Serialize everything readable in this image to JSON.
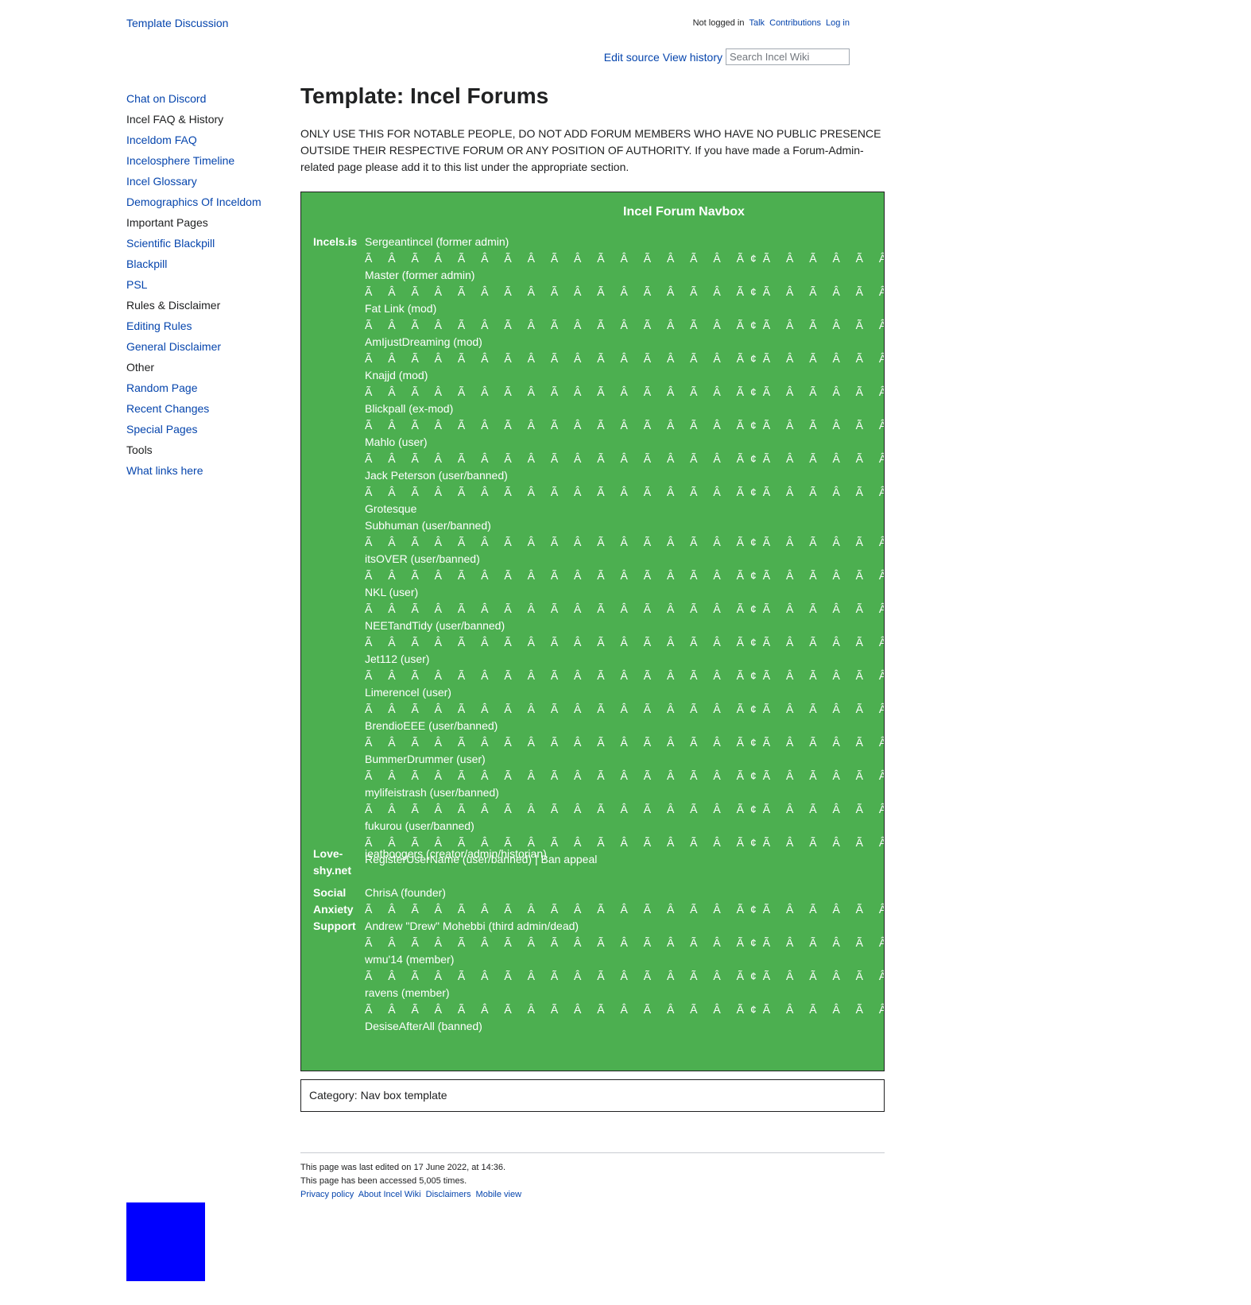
{
  "header": {
    "namespace_tabs": [
      "Template",
      "Discussion"
    ],
    "personal": {
      "status": "Not logged in",
      "links": [
        "Talk",
        "Contributions",
        "Log in"
      ]
    },
    "actions": [
      "Edit source",
      "View history"
    ],
    "search_placeholder": "Search Incel Wiki"
  },
  "sidebar": {
    "items": [
      {
        "label": "Chat on Discord",
        "type": "link"
      },
      {
        "label": "Incel FAQ & History",
        "type": "heading"
      },
      {
        "label": "Inceldom FAQ",
        "type": "link"
      },
      {
        "label": "Incelosphere Timeline",
        "type": "link"
      },
      {
        "label": "Incel Glossary",
        "type": "link"
      },
      {
        "label": "Demographics Of Inceldom",
        "type": "link"
      },
      {
        "label": "Important Pages",
        "type": "heading"
      },
      {
        "label": "Scientific Blackpill",
        "type": "link"
      },
      {
        "label": "Blackpill",
        "type": "link"
      },
      {
        "label": "PSL",
        "type": "link"
      },
      {
        "label": "Rules & Disclaimer",
        "type": "heading"
      },
      {
        "label": "Editing Rules",
        "type": "link"
      },
      {
        "label": "General Disclaimer",
        "type": "link"
      },
      {
        "label": "Other",
        "type": "heading"
      },
      {
        "label": "Random Page",
        "type": "link"
      },
      {
        "label": "Recent Changes",
        "type": "link"
      },
      {
        "label": "Special Pages",
        "type": "link"
      },
      {
        "label": "Tools",
        "type": "heading"
      },
      {
        "label": "What links here",
        "type": "link"
      }
    ]
  },
  "page": {
    "title": "Template: Incel Forums",
    "intro": "ONLY USE THIS FOR NOTABLE PEOPLE, DO NOT ADD FORUM MEMBERS WHO HAVE NO PUBLIC PRESENCE OUTSIDE THEIR RESPECTIVE FORUM OR ANY POSITION OF AUTHORITY. If you have made a Forum-Admin-related page please add it to this list under the appropriate section."
  },
  "navbox": {
    "title": "Incel Forum Navbox",
    "separator": "Ã Â Ã Â Ã Â Ã Â Ã Â Ã Â Ã Â Ã Â Ã¢Ã Â Ã Â Ã Â Ã Â Ã Â Ã Â Ã Â Ã Â Ã",
    "groups": [
      {
        "name": "Incels.is",
        "lines": [
          "Sergeantincel (former admin)",
          "sep",
          "Master (former admin)",
          "sep",
          "Fat Link (mod)",
          "sep",
          "AmIjustDreaming (mod)",
          "sep",
          "Knajjd (mod)",
          "sep",
          "Blickpall (ex-mod)",
          "sep",
          "Mahlo (user)",
          "sep",
          "Jack Peterson (user/banned)",
          "sep",
          "Grotesque",
          "Subhuman (user/banned)",
          "sep",
          "itsOVER (user/banned)",
          "sep",
          "NKL (user)",
          "sep",
          "NEETandTidy (user/banned)",
          "sep",
          "Jet112 (user)",
          "sep",
          "Limerencel (user)",
          "sep",
          "BrendioEEE (user/banned)",
          "sep",
          "BummerDrummer (user)",
          "sep",
          "mylifeistrash (user/banned)",
          "sep",
          "fukurou (user/banned)",
          "sep",
          "RegisterUserName (user/banned) | Ban appeal"
        ]
      },
      {
        "name": "Love-shy.net",
        "lines": [
          "ieatboogers (creator/admin/historian)"
        ]
      },
      {
        "name": "Social Anxiety Support",
        "lines": [
          "ChrisA (founder)",
          "sep",
          "Andrew \"Drew\" Mohebbi (third admin/dead)",
          "sep",
          "wmu'14 (member)",
          "sep",
          "ravens (member)",
          "sep",
          "DesiseAfterAll (banned)"
        ]
      }
    ]
  },
  "category": "Category: Nav box template",
  "footer": {
    "last_edited": "This page was last edited on 17 June 2022, at 14:36.",
    "accessed": "This page has been accessed 5,005 times.",
    "links": [
      "Privacy policy",
      "About Incel Wiki",
      "Disclaimers",
      "Mobile view"
    ]
  },
  "colors": {
    "navbox_bg": "#4caf50",
    "link": "#0645ad",
    "blue_box": "#0000ff"
  }
}
